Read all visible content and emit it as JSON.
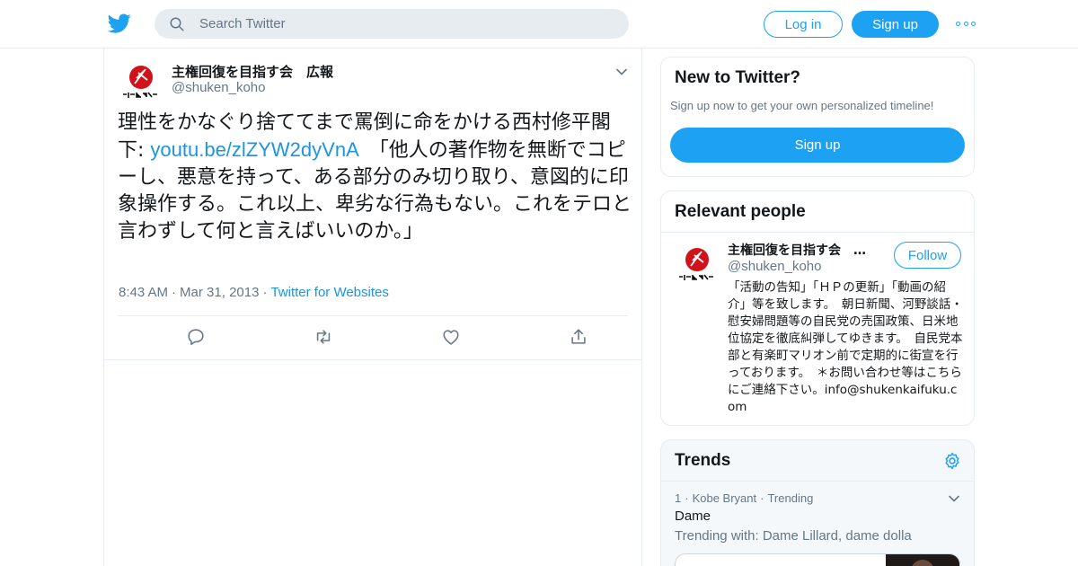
{
  "topbar": {
    "search_placeholder": "Search Twitter",
    "login_label": "Log in",
    "signup_label": "Sign up",
    "more_icon": "more-dots-icon"
  },
  "tweet": {
    "author_name": "主権回復を目指す会　広報",
    "author_handle": "@shuken_koho",
    "text_before_link": "理性をかなぐり捨ててまで罵倒に命をかける西村修平閣下: ",
    "link_text": "youtu.be/zlZYW2dyVnA",
    "text_after_link": "　「他人の著作物を無断でコピーし、悪意を持って、ある部分のみ切り取り、意図的に印象操作する。これ以上、卑劣な行為もない。これをテロと言わずして何と言えばいいのか。」",
    "time": "8:43 AM",
    "date": "Mar 31, 2013",
    "source": "Twitter for Websites",
    "actions": [
      "reply-icon",
      "retweet-icon",
      "like-icon",
      "share-icon"
    ]
  },
  "new_to_twitter": {
    "title": "New to Twitter?",
    "subtitle": "Sign up now to get your own personalized timeline!",
    "button": "Sign up"
  },
  "relevant_people": {
    "title": "Relevant people",
    "person": {
      "name": "主権回復を目指す会　…",
      "handle": "@shuken_koho",
      "follow_label": "Follow",
      "bio": "「活動の告知」「ＨＰの更新」「動画の紹介」等を致します。　朝日新聞、河野談話・慰安婦問題等の自民党の売国政策、日米地位協定を徹底糾弾してゆきます。　自民党本部と有楽町マリオン前で定期的に街宣を行っております。　＊お問い合わせ等はこちらにご連絡下さい。info@shukenkaifuku.com"
    }
  },
  "trends": {
    "title": "Trends",
    "items": [
      {
        "rank": "1",
        "context": "Kobe Bryant",
        "status": "Trending",
        "name": "Dame",
        "trending_with": "Trending with: Dame Lillard, dame dolla"
      }
    ]
  },
  "colors": {
    "accent": "#1da1f2",
    "link": "#1b95e0",
    "text": "#14171a",
    "muted": "#657786",
    "border": "#e6ecf0"
  }
}
